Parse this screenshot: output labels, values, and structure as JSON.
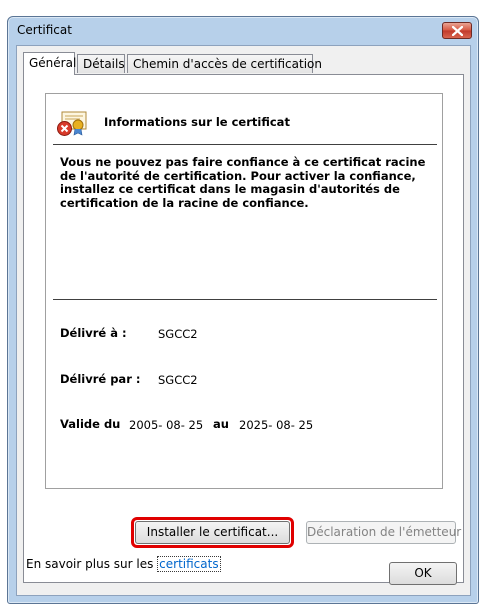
{
  "window": {
    "title": "Certificat",
    "close_icon": "close-icon"
  },
  "tabs": [
    {
      "label": "Général",
      "active": true
    },
    {
      "label": "Détails",
      "active": false
    },
    {
      "label": "Chemin d'accès de certification",
      "active": false
    }
  ],
  "info": {
    "heading": "Informations sur le certificat",
    "icon": "certificate-error-icon",
    "warning": "Vous ne pouvez pas faire confiance à ce certificat racine de l'autorité de certification. Pour activer la confiance, installez ce certificat dans le magasin d'autorités de certification de la racine de confiance."
  },
  "fields": {
    "issued_to_label": "Délivré à :",
    "issued_to_value": "SGCC2",
    "issued_by_label": "Délivré par :",
    "issued_by_value": "SGCC2",
    "valid_from_label": "Valide du",
    "valid_from_value": "2005- 08- 25",
    "valid_to_label": "au",
    "valid_to_value": "2025- 08- 25"
  },
  "buttons": {
    "install": "Installer le certificat...",
    "issuer_statement": "Déclaration de l'émetteur",
    "ok": "OK"
  },
  "learn_more": {
    "prefix": "En savoir plus sur les ",
    "link": "certificats"
  },
  "colors": {
    "highlight": "#e00000",
    "link": "#0066cc",
    "close_button": "#c0392b"
  }
}
